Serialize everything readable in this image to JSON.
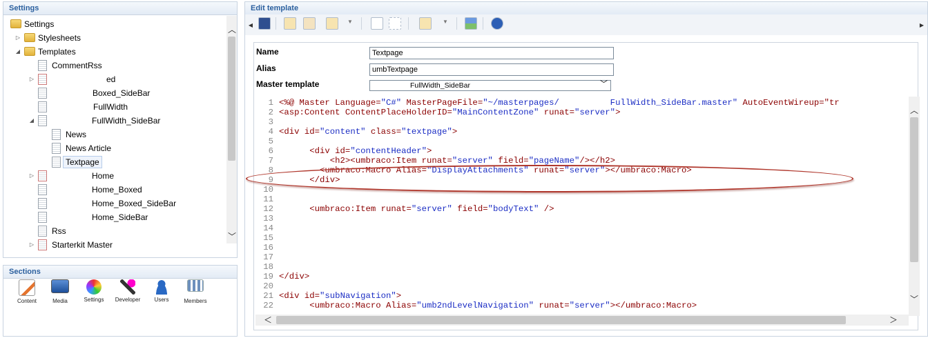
{
  "settings_panel": {
    "title": "Settings",
    "tree": [
      {
        "label": "Settings",
        "icon": "folder-icon"
      },
      {
        "label": "Stylesheets",
        "icon": "folder-icon"
      },
      {
        "label": "Templates",
        "icon": "folder-icon"
      },
      {
        "label": "CommentRss",
        "icon": "template-icon"
      },
      {
        "label": "ed",
        "icon": "template-icon"
      },
      {
        "label": "Boxed_SideBar",
        "icon": "template-icon"
      },
      {
        "label": "FullWidth",
        "icon": "template-icon"
      },
      {
        "label": "FullWidth_SideBar",
        "icon": "template-icon"
      },
      {
        "label": "News",
        "icon": "template-icon"
      },
      {
        "label": "News Article",
        "icon": "template-icon"
      },
      {
        "label": "Textpage",
        "icon": "template-icon"
      },
      {
        "label": "Home",
        "icon": "template-icon"
      },
      {
        "label": "Home_Boxed",
        "icon": "template-icon"
      },
      {
        "label": "Home_Boxed_SideBar",
        "icon": "template-icon"
      },
      {
        "label": "Home_SideBar",
        "icon": "template-icon"
      },
      {
        "label": "Rss",
        "icon": "template-icon"
      },
      {
        "label": "Starterkit Master",
        "icon": "template-icon"
      }
    ]
  },
  "sections_panel": {
    "title": "Sections",
    "items": [
      {
        "label": "Content",
        "icon": "content-icon"
      },
      {
        "label": "Media",
        "icon": "media-icon"
      },
      {
        "label": "Settings",
        "icon": "settings-icon"
      },
      {
        "label": "Developer",
        "icon": "developer-icon"
      },
      {
        "label": "Users",
        "icon": "users-icon"
      },
      {
        "label": "Members",
        "icon": "members-icon"
      }
    ]
  },
  "editor": {
    "title": "Edit template",
    "name_label": "Name",
    "name_value": "Textpage",
    "alias_label": "Alias",
    "alias_value": "umbTextpage",
    "master_label": "Master template",
    "master_value": "FullWidth_SideBar",
    "code_lines": [
      "<%@ Master Language=\"C#\" MasterPageFile=\"~/masterpages/          FullWidth_SideBar.master\" AutoEventWireup=\"tr",
      "<asp:Content ContentPlaceHolderID=\"MainContentZone\" runat=\"server\">",
      "",
      "<div id=\"content\" class=\"textpage\">",
      "",
      "      <div id=\"contentHeader\">",
      "          <h2><umbraco:Item runat=\"server\" field=\"pageName\"/></h2>",
      "        <umbraco:Macro Alias=\"DisplayAttachments\" runat=\"server\"></umbraco:Macro>",
      "      </div>",
      "",
      "",
      "      <umbraco:Item runat=\"server\" field=\"bodyText\" />",
      "",
      "",
      "",
      "",
      "",
      "",
      "</div>",
      "",
      "<div id=\"subNavigation\">",
      "      <umbraco:Macro Alias=\"umb2ndLevelNavigation\" runat=\"server\"></umbraco:Macro>"
    ]
  }
}
